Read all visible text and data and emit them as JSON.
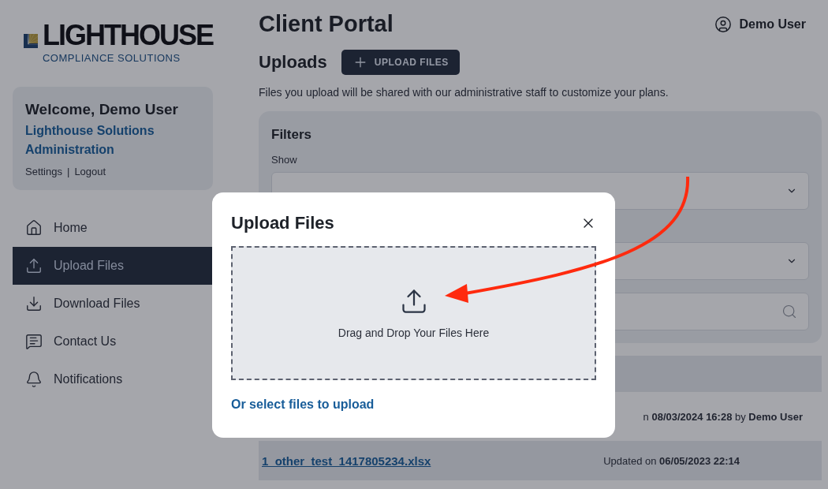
{
  "logo": {
    "name": "LIGHTHOUSE",
    "tagline": "COMPLIANCE SOLUTIONS"
  },
  "welcome": {
    "greeting": "Welcome, Demo User",
    "organization": "Lighthouse Solutions Administration",
    "links": [
      "Settings",
      "Logout"
    ],
    "separator": "|"
  },
  "nav": [
    {
      "label": "Home",
      "selected": false
    },
    {
      "label": "Upload Files",
      "selected": true
    },
    {
      "label": "Download Files",
      "selected": false
    },
    {
      "label": "Contact Us",
      "selected": false
    },
    {
      "label": "Notifications",
      "selected": false
    }
  ],
  "header": {
    "title": "Client Portal",
    "user": "Demo User"
  },
  "uploads": {
    "title": "Uploads",
    "button": "UPLOAD FILES",
    "description": "Files you upload will be shared with our administrative staff to customize your plans."
  },
  "filters": {
    "title": "Filters",
    "show_label": "Show"
  },
  "files": [
    {
      "meta": "n **08/03/2024 16:28** by **Demo User**"
    },
    {
      "name": "1_other_test_1417805234.xlsx",
      "meta": "Updated on **06/05/2023 22:14**"
    }
  ],
  "modal": {
    "title": "Upload Files",
    "drop_text": "Drag and Drop Your Files Here",
    "select_link": "Or select files to upload"
  }
}
